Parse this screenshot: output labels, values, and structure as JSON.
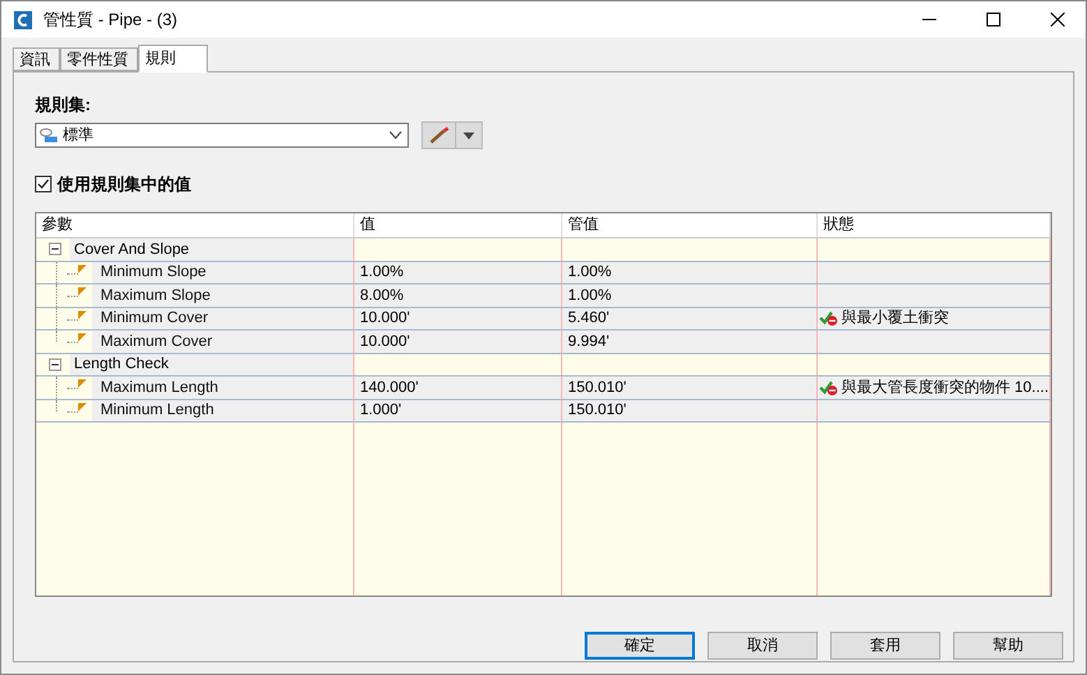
{
  "window": {
    "title": "管性質 - Pipe - (3)"
  },
  "tabs": [
    {
      "label": "資訊",
      "selected": false
    },
    {
      "label": "零件性質",
      "selected": false
    },
    {
      "label": "規則",
      "selected": true
    }
  ],
  "rule_set": {
    "label": "規則集:",
    "value": "標準"
  },
  "use_rule_values": {
    "label": "使用規則集中的值",
    "checked": true
  },
  "table": {
    "columns": [
      "參數",
      "值",
      "管值",
      "狀態"
    ],
    "groups": [
      {
        "name": "Cover And Slope",
        "expanded": true,
        "children": [
          {
            "name": "Minimum Slope",
            "value": "1.00%",
            "pipe_value": "1.00%",
            "violation": false
          },
          {
            "name": "Maximum Slope",
            "value": "8.00%",
            "pipe_value": "1.00%",
            "violation": false
          },
          {
            "name": "Minimum Cover",
            "value": "10.000'",
            "pipe_value": "5.460'",
            "violation": true,
            "status": "與最小覆土衝突"
          },
          {
            "name": "Maximum Cover",
            "value": "10.000'",
            "pipe_value": "9.994'",
            "violation": false
          }
        ]
      },
      {
        "name": "Length Check",
        "expanded": true,
        "children": [
          {
            "name": "Maximum Length",
            "value": "140.000'",
            "pipe_value": "150.010'",
            "violation": true,
            "status": "與最大管長度衝突的物件 10...."
          },
          {
            "name": "Minimum Length",
            "value": "1.000'",
            "pipe_value": "150.010'",
            "violation": false
          }
        ]
      }
    ]
  },
  "buttons": [
    {
      "label": "確定",
      "default": true
    },
    {
      "label": "取消",
      "default": false
    },
    {
      "label": "套用",
      "default": false
    },
    {
      "label": "幫助",
      "default": false
    }
  ]
}
